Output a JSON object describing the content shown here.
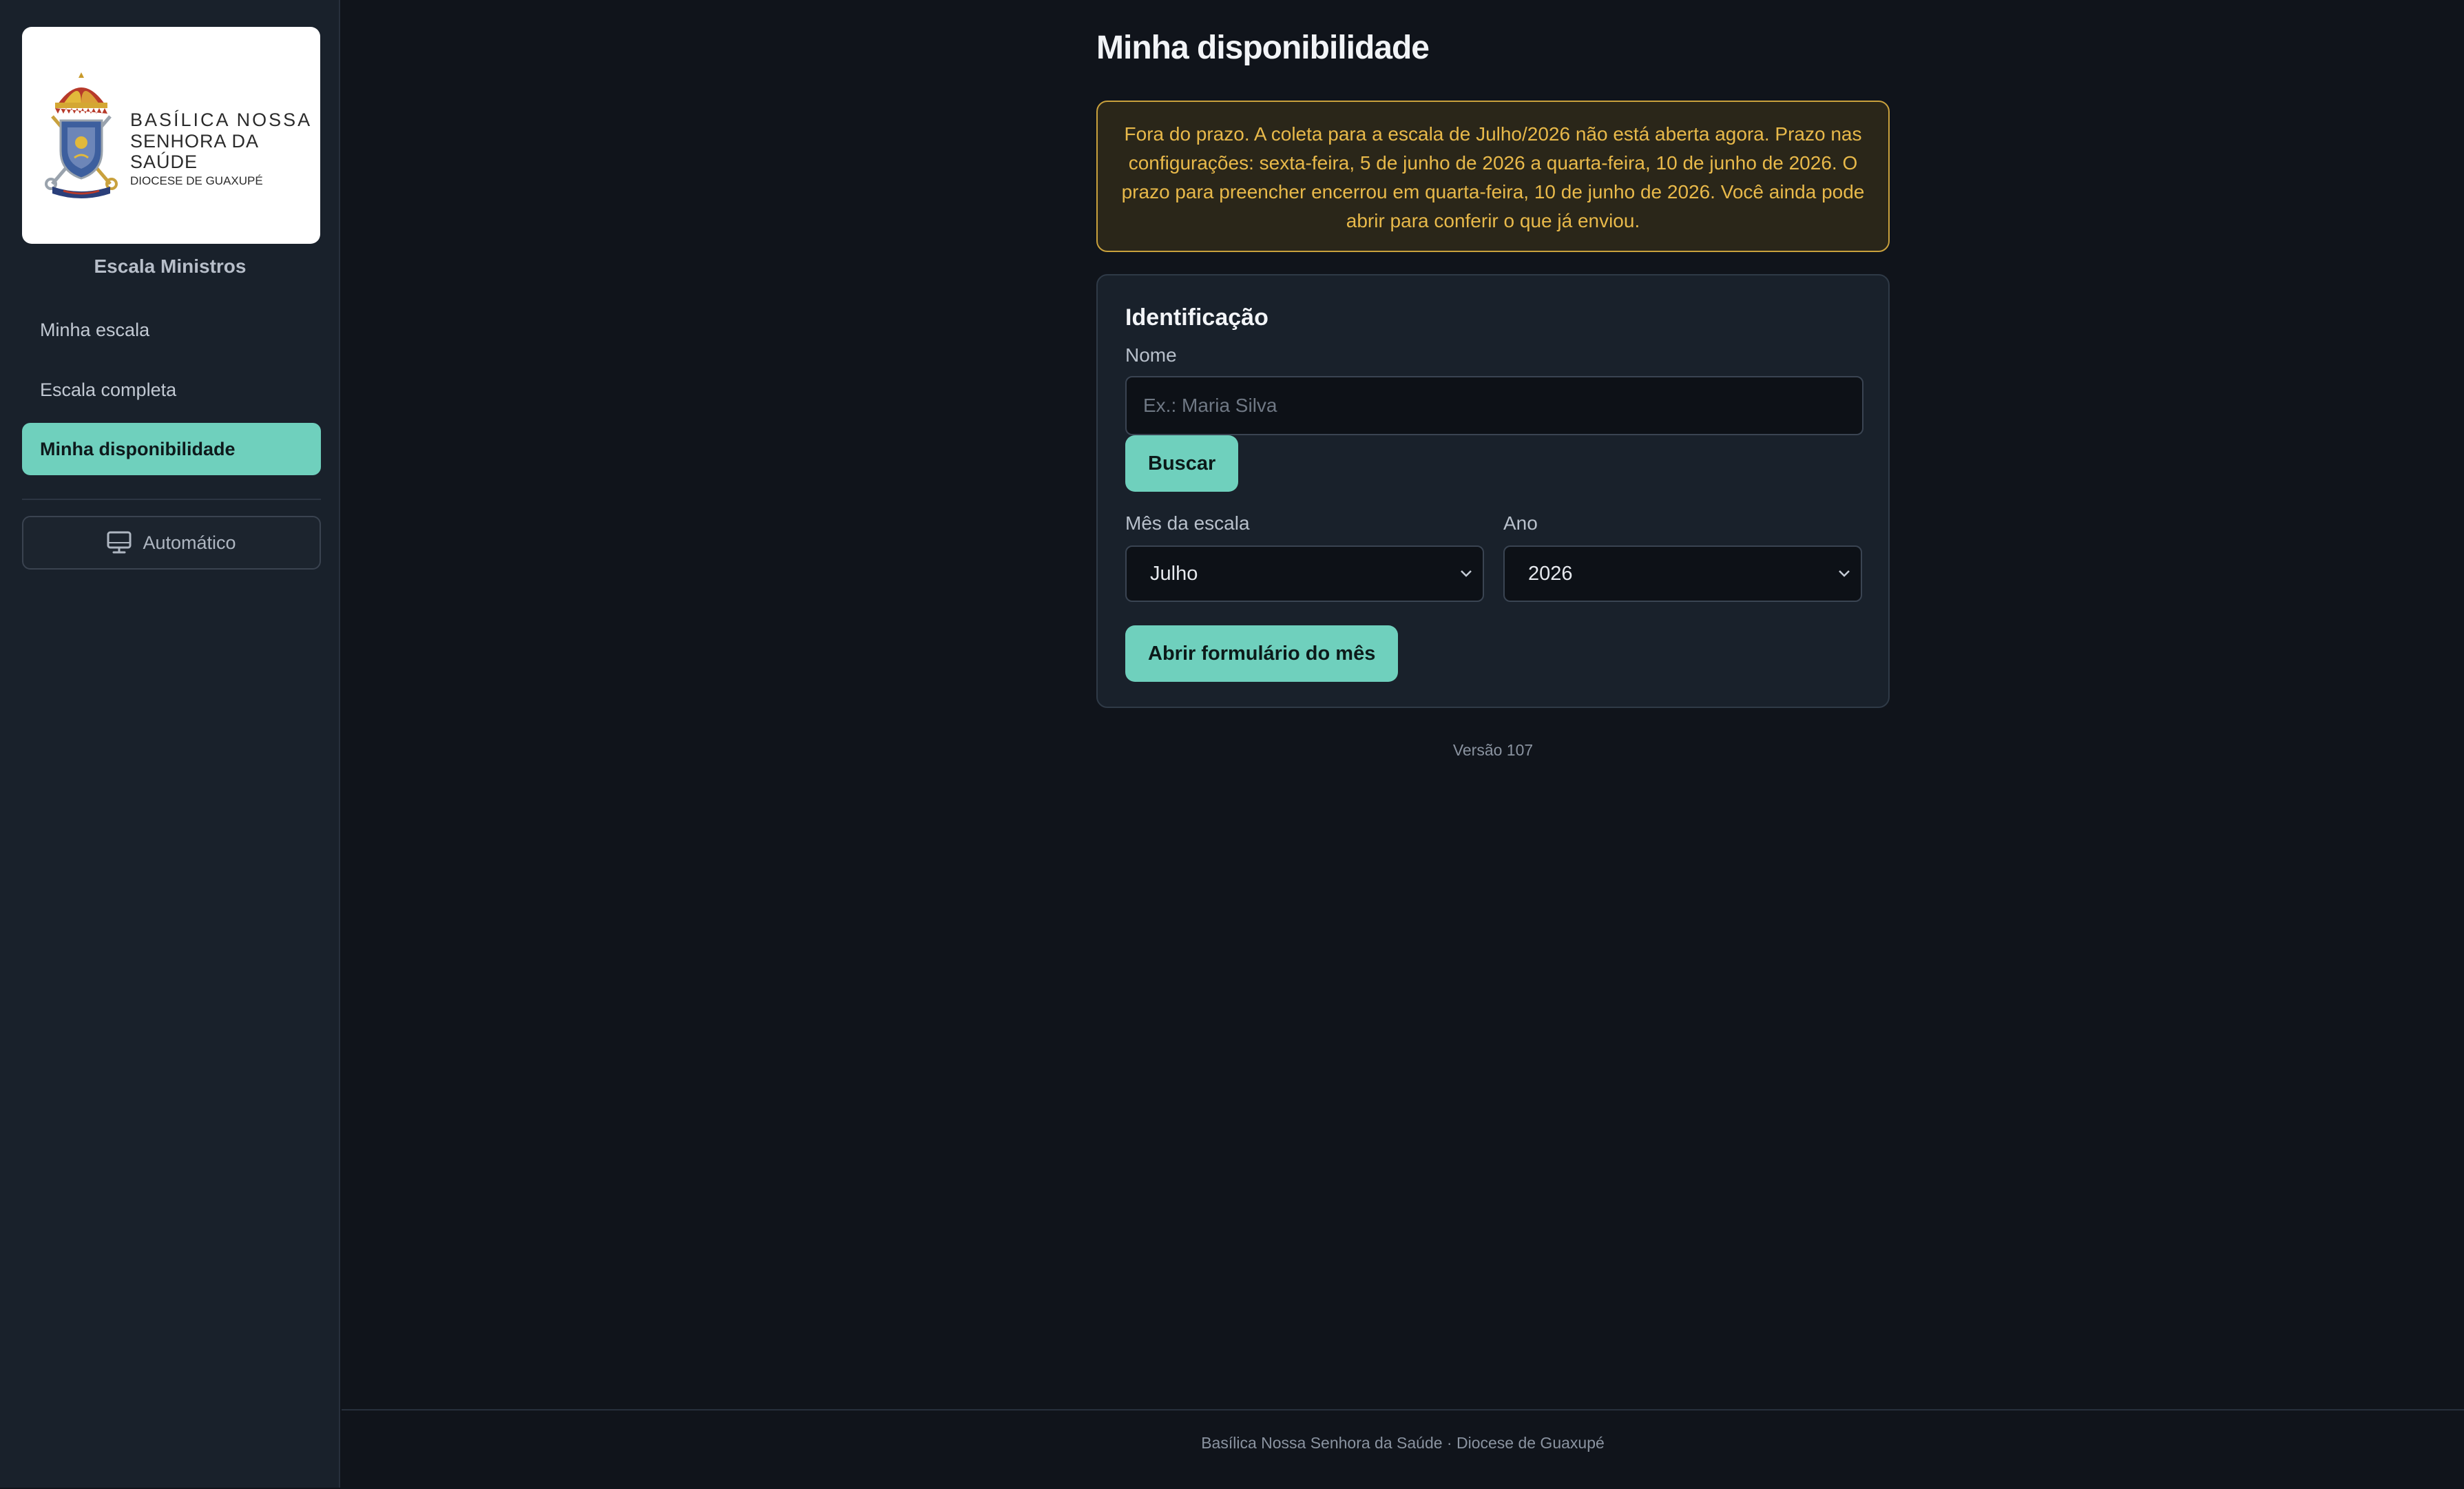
{
  "sidebar": {
    "logo": {
      "line1": "BASÍLICA NOSSA",
      "line2": "SENHORA DA SAÚDE",
      "line3": "DIOCESE DE GUAXUPÉ"
    },
    "app_name": "Escala Ministros",
    "items": [
      {
        "label": "Minha escala",
        "active": false
      },
      {
        "label": "Escala completa",
        "active": false
      },
      {
        "label": "Minha disponibilidade",
        "active": true
      }
    ],
    "theme_button": {
      "label": "Automático",
      "icon": "monitor-icon"
    }
  },
  "main": {
    "title": "Minha disponibilidade",
    "alert": "Fora do prazo. A coleta para a escala de Julho/2026 não está aberta agora. Prazo nas configurações: sexta-feira, 5 de junho de 2026 a quarta-feira, 10 de junho de 2026. O prazo para preencher encerrou em quarta-feira, 10 de junho de 2026. Você ainda pode abrir para conferir o que já enviou.",
    "card": {
      "title": "Identificação",
      "name_label": "Nome",
      "name_value": "",
      "name_placeholder": "Ex.: Maria Silva",
      "search_button": "Buscar",
      "month_label": "Mês da escala",
      "month_value": "Julho",
      "year_label": "Ano",
      "year_value": "2026",
      "open_button": "Abrir formulário do mês"
    },
    "version": "Versão 107"
  },
  "footer": {
    "text": "Basílica Nossa Senhora da Saúde · Diocese de Guaxupé"
  },
  "colors": {
    "accent": "#6fd0bd",
    "background": "#10141b",
    "sidebar": "#19212b",
    "warning": "#e8b94a"
  }
}
